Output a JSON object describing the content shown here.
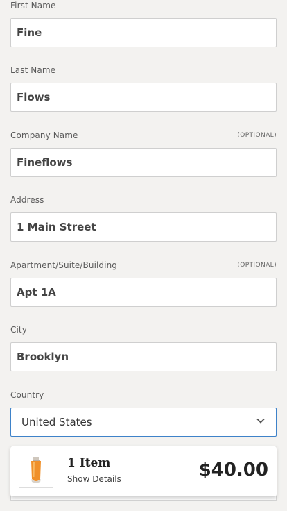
{
  "form": {
    "first_name": {
      "label": "First Name",
      "value": "Fine"
    },
    "last_name": {
      "label": "Last Name",
      "value": "Flows"
    },
    "company": {
      "label": "Company Name",
      "optional": "(OPTIONAL)",
      "value": "Fineflows"
    },
    "address": {
      "label": "Address",
      "value": "1 Main Street"
    },
    "apartment": {
      "label": "Apartment/Suite/Building",
      "optional": "(OPTIONAL)",
      "value": "Apt 1A"
    },
    "city": {
      "label": "City",
      "value": "Brooklyn"
    },
    "country": {
      "label": "Country",
      "value": "United States"
    }
  },
  "cart": {
    "items_label": "1 Item",
    "details_link": "Show Details",
    "price": "$40.00",
    "product_icon": "orange-tube-icon"
  },
  "colors": {
    "background": "#f3f2f0",
    "focus_border": "#3e82c9"
  }
}
